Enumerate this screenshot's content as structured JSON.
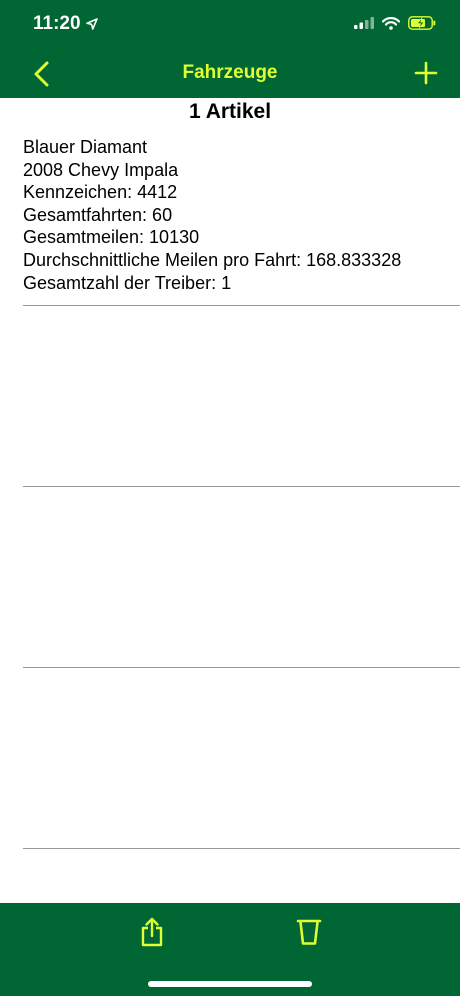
{
  "status_bar": {
    "time": "11:20",
    "icons": [
      "location-arrow-icon",
      "signal-icon",
      "wifi-icon",
      "battery-charging-icon"
    ]
  },
  "nav": {
    "title": "Fahrzeuge",
    "back_icon": "chevron-left-icon",
    "add_icon": "plus-icon"
  },
  "list": {
    "count_label": "1 Artikel",
    "items": [
      {
        "name": "Blauer Diamant",
        "model": "2008 Chevy Impala",
        "plate": "Kennzeichen: 4412",
        "total_trips": "Gesamtfahrten: 60",
        "total_miles": "Gesamtmeilen: 10130",
        "avg_miles": "Durchschnittliche Meilen pro Fahrt: 168.833328",
        "total_drivers": "Gesamtzahl der Treiber: 1"
      }
    ]
  },
  "toolbar": {
    "share_icon": "share-icon",
    "trash_icon": "trash-icon"
  },
  "colors": {
    "bar_green": "#006633",
    "accent_yellow": "#ddff33",
    "separator": "#999999"
  }
}
